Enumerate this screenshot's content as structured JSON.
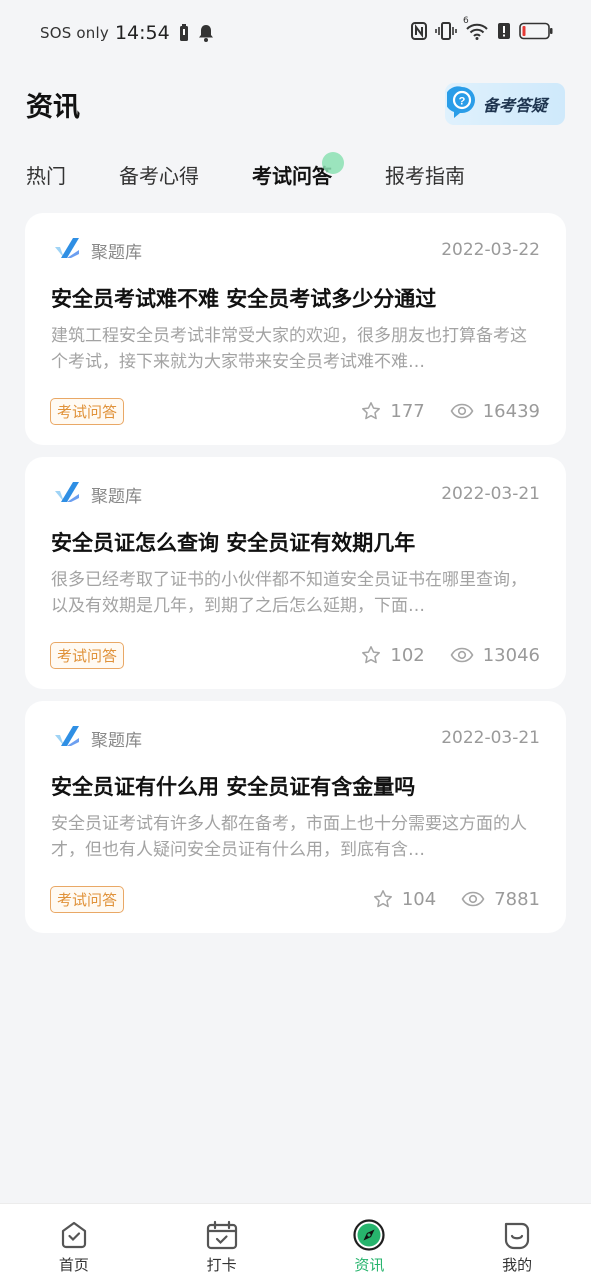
{
  "status_bar": {
    "carrier": "SOS only",
    "time": "14:54",
    "signal_label": "6"
  },
  "header": {
    "title": "资讯",
    "qa_button_label": "备考答疑"
  },
  "tabs": [
    {
      "label": "热门",
      "active": false
    },
    {
      "label": "备考心得",
      "active": false
    },
    {
      "label": "考试问答",
      "active": true
    },
    {
      "label": "报考指南",
      "active": false
    }
  ],
  "articles": [
    {
      "source": "聚题库",
      "date": "2022-03-22",
      "title": "安全员考试难不难  安全员考试多少分通过",
      "summary": "建筑工程安全员考试非常受大家的欢迎，很多朋友也打算备考这个考试，接下来就为大家带来安全员考试难不难…",
      "tag": "考试问答",
      "stars": "177",
      "views": "16439"
    },
    {
      "source": "聚题库",
      "date": "2022-03-21",
      "title": "安全员证怎么查询 安全员证有效期几年",
      "summary": "很多已经考取了证书的小伙伴都不知道安全员证书在哪里查询，以及有效期是几年，到期了之后怎么延期，下面…",
      "tag": "考试问答",
      "stars": "102",
      "views": "13046"
    },
    {
      "source": "聚题库",
      "date": "2022-03-21",
      "title": "安全员证有什么用 安全员证有含金量吗",
      "summary": "安全员证考试有许多人都在备考，市面上也十分需要这方面的人才，但也有人疑问安全员证有什么用，到底有含…",
      "tag": "考试问答",
      "stars": "104",
      "views": "7881"
    }
  ],
  "bottom_nav": [
    {
      "label": "首页",
      "icon": "home-icon",
      "active": false
    },
    {
      "label": "打卡",
      "icon": "calendar-icon",
      "active": false
    },
    {
      "label": "资讯",
      "icon": "compass-icon",
      "active": true
    },
    {
      "label": "我的",
      "icon": "profile-icon",
      "active": false
    }
  ],
  "colors": {
    "accent": "#27b46d",
    "tag": "#e0923a",
    "background": "#f4f5f7"
  }
}
